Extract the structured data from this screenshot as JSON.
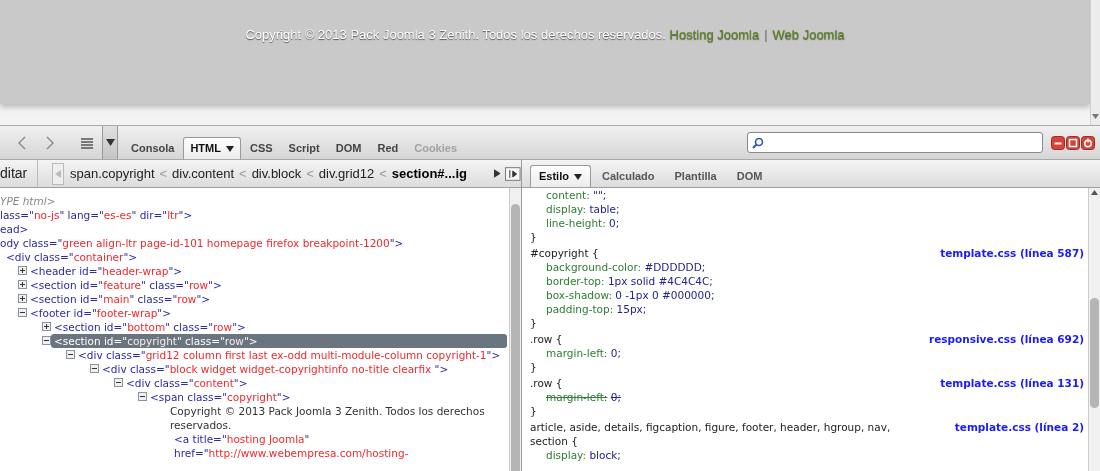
{
  "page": {
    "footer_parts": [
      {
        "kind": "text",
        "text": "Copyright © 2013 Pack Joomla 3 Zenith. Todos los derechos reservados."
      },
      {
        "kind": "link",
        "text": "Hosting Joomla"
      },
      {
        "kind": "separator",
        "text": "|"
      },
      {
        "kind": "link",
        "text": "Web Joomla"
      }
    ]
  },
  "toolbar": {
    "tabs": [
      {
        "label": "Consola",
        "selected": false,
        "disabled": false,
        "menu": false
      },
      {
        "label": "HTML",
        "selected": true,
        "disabled": false,
        "menu": true
      },
      {
        "label": "CSS",
        "selected": false,
        "disabled": false,
        "menu": false
      },
      {
        "label": "Script",
        "selected": false,
        "disabled": false,
        "menu": false
      },
      {
        "label": "DOM",
        "selected": false,
        "disabled": false,
        "menu": false
      },
      {
        "label": "Red",
        "selected": false,
        "disabled": false,
        "menu": false
      },
      {
        "label": "Cookies",
        "selected": false,
        "disabled": true,
        "menu": false
      }
    ]
  },
  "breadcrumb": {
    "edit_button": "ditar",
    "items": [
      {
        "kind": "crumb",
        "label": "span.copyright",
        "selected": false
      },
      {
        "kind": "separator",
        "label": "<"
      },
      {
        "kind": "crumb",
        "label": "div.content",
        "selected": false
      },
      {
        "kind": "separator",
        "label": "<"
      },
      {
        "kind": "crumb",
        "label": "div.block",
        "selected": false
      },
      {
        "kind": "separator",
        "label": "<"
      },
      {
        "kind": "crumb",
        "label": "div.grid12",
        "selected": false
      },
      {
        "kind": "separator",
        "label": "<"
      },
      {
        "kind": "crumb",
        "label": "section#...ig",
        "selected": true
      }
    ]
  },
  "html_tree": [
    {
      "kind": "doctype",
      "parts": [
        {
          "kind": "comment",
          "text": "YPE html>"
        }
      ]
    },
    {
      "kind": "element",
      "selected": false,
      "parts": [
        {
          "kind": "markup",
          "text": "lass=\""
        },
        {
          "kind": "value",
          "text": "no-js"
        },
        {
          "kind": "markup",
          "text": "\" lang=\""
        },
        {
          "kind": "value",
          "text": "es-es"
        },
        {
          "kind": "markup",
          "text": "\" dir=\""
        },
        {
          "kind": "value",
          "text": "ltr"
        },
        {
          "kind": "markup",
          "text": "\">"
        }
      ],
      "children": [
        {
          "kind": "element",
          "selected": false,
          "parts": [
            {
              "kind": "markup",
              "text": "ead>"
            }
          ]
        },
        {
          "kind": "element",
          "selected": false,
          "parts": [
            {
              "kind": "markup",
              "text": "ody class=\""
            },
            {
              "kind": "value",
              "text": "green align-ltr page-id-101 homepage firefox breakpoint-1200"
            },
            {
              "kind": "markup",
              "text": "\">"
            }
          ],
          "children": [
            {
              "kind": "element",
              "selected": false,
              "parts": [
                {
                  "kind": "markup",
                  "text": "<div class=\""
                },
                {
                  "kind": "value",
                  "text": "container"
                },
                {
                  "kind": "markup",
                  "text": "\">"
                }
              ],
              "children": [
                {
                  "kind": "element",
                  "selected": false,
                  "expanded": false,
                  "parts": [
                    {
                      "kind": "markup",
                      "text": "<header id=\""
                    },
                    {
                      "kind": "value",
                      "text": "header-wrap"
                    },
                    {
                      "kind": "markup",
                      "text": "\">"
                    }
                  ]
                },
                {
                  "kind": "element",
                  "selected": false,
                  "expanded": false,
                  "parts": [
                    {
                      "kind": "markup",
                      "text": "<section id=\""
                    },
                    {
                      "kind": "value",
                      "text": "feature"
                    },
                    {
                      "kind": "markup",
                      "text": "\" class=\""
                    },
                    {
                      "kind": "value",
                      "text": "row"
                    },
                    {
                      "kind": "markup",
                      "text": "\">"
                    }
                  ]
                },
                {
                  "kind": "element",
                  "selected": false,
                  "expanded": false,
                  "parts": [
                    {
                      "kind": "markup",
                      "text": "<section id=\""
                    },
                    {
                      "kind": "value",
                      "text": "main"
                    },
                    {
                      "kind": "markup",
                      "text": "\" class=\""
                    },
                    {
                      "kind": "value",
                      "text": "row"
                    },
                    {
                      "kind": "markup",
                      "text": "\">"
                    }
                  ]
                },
                {
                  "kind": "element",
                  "selected": false,
                  "expanded": true,
                  "parts": [
                    {
                      "kind": "markup",
                      "text": "<footer id=\""
                    },
                    {
                      "kind": "value",
                      "text": "footer-wrap"
                    },
                    {
                      "kind": "markup",
                      "text": "\">"
                    }
                  ],
                  "children": [
                    {
                      "kind": "element",
                      "selected": false,
                      "expanded": false,
                      "parts": [
                        {
                          "kind": "markup",
                          "text": "<section id=\""
                        },
                        {
                          "kind": "value",
                          "text": "bottom"
                        },
                        {
                          "kind": "markup",
                          "text": "\" class=\""
                        },
                        {
                          "kind": "value",
                          "text": "row"
                        },
                        {
                          "kind": "markup",
                          "text": "\">"
                        }
                      ]
                    },
                    {
                      "kind": "element",
                      "selected": true,
                      "expanded": true,
                      "parts": [
                        {
                          "kind": "markup",
                          "text": "<section id=\""
                        },
                        {
                          "kind": "value",
                          "text": "copyright"
                        },
                        {
                          "kind": "markup",
                          "text": "\" class=\""
                        },
                        {
                          "kind": "value",
                          "text": "row"
                        },
                        {
                          "kind": "markup",
                          "text": "\">"
                        }
                      ],
                      "children": [
                        {
                          "kind": "element",
                          "selected": false,
                          "expanded": true,
                          "parts": [
                            {
                              "kind": "markup",
                              "text": "<div class=\""
                            },
                            {
                              "kind": "value",
                              "text": "grid12 column first last ex-odd multi-module-column copyright-1"
                            },
                            {
                              "kind": "markup",
                              "text": "\">"
                            }
                          ],
                          "children": [
                            {
                              "kind": "element",
                              "selected": false,
                              "expanded": true,
                              "parts": [
                                {
                                  "kind": "markup",
                                  "text": "<div class=\""
                                },
                                {
                                  "kind": "value",
                                  "text": "block widget widget-copyrightinfo no-title clearfix "
                                },
                                {
                                  "kind": "markup",
                                  "text": "\">"
                                }
                              ],
                              "children": [
                                {
                                  "kind": "element",
                                  "selected": false,
                                  "expanded": true,
                                  "parts": [
                                    {
                                      "kind": "markup",
                                      "text": "<div class=\""
                                    },
                                    {
                                      "kind": "value",
                                      "text": "content"
                                    },
                                    {
                                      "kind": "markup",
                                      "text": "\">"
                                    }
                                  ],
                                  "children": [
                                    {
                                      "kind": "element",
                                      "selected": false,
                                      "expanded": true,
                                      "parts": [
                                        {
                                          "kind": "markup",
                                          "text": "<span class=\""
                                        },
                                        {
                                          "kind": "value",
                                          "text": "copyright"
                                        },
                                        {
                                          "kind": "markup",
                                          "text": "\">"
                                        }
                                      ],
                                      "children": [
                                        {
                                          "kind": "text",
                                          "parts": [
                                            {
                                              "kind": "text",
                                              "text": "Copyright © 2013 Pack Joomla 3 Zenith. Todos los derechos reservados."
                                            }
                                          ]
                                        },
                                        {
                                          "kind": "element",
                                          "selected": false,
                                          "parts": [
                                            {
                                              "kind": "markup",
                                              "text": "<a title=\""
                                            },
                                            {
                                              "kind": "value",
                                              "text": "hosting Joomla"
                                            },
                                            {
                                              "kind": "markup",
                                              "text": "\" href=\""
                                            },
                                            {
                                              "kind": "value",
                                              "text": "http://www.webempresa.com/hosting-"
                                            }
                                          ]
                                        }
                                      ]
                                    }
                                  ]
                                }
                              ]
                            }
                          ]
                        }
                      ]
                    }
                  ]
                }
              ]
            }
          ]
        }
      ]
    }
  ],
  "style_panel": {
    "tabs": [
      {
        "label": "Estilo",
        "selected": true,
        "menu": true
      },
      {
        "label": "Calculado",
        "selected": false,
        "menu": false
      },
      {
        "label": "Plantilla",
        "selected": false,
        "menu": false
      },
      {
        "label": "DOM",
        "selected": false,
        "menu": false
      }
    ],
    "rules": [
      {
        "declarations": [
          {
            "name": "content:",
            "value": "\"\";",
            "overridden": false
          },
          {
            "name": "display:",
            "value": "table;",
            "overridden": false
          },
          {
            "name": "line-height:",
            "value": "0;",
            "overridden": false
          }
        ],
        "close": "}"
      },
      {
        "selector": "#copyright {",
        "source": "template.css (línea 587)",
        "declarations": [
          {
            "name": "background-color:",
            "value": "#DDDDDD;",
            "overridden": false
          },
          {
            "name": "border-top:",
            "value": "1px solid #4C4C4C;",
            "overridden": false
          },
          {
            "name": "box-shadow:",
            "value": "0 -1px 0 #000000;",
            "overridden": false
          },
          {
            "name": "padding-top:",
            "value": "15px;",
            "overridden": false
          }
        ],
        "close": "}"
      },
      {
        "selector": ".row {",
        "source": "responsive.css (línea 692)",
        "declarations": [
          {
            "name": "margin-left:",
            "value": "0;",
            "overridden": false
          }
        ],
        "close": "}"
      },
      {
        "selector": ".row {",
        "source": "template.css (línea 131)",
        "declarations": [
          {
            "name": "margin-left:",
            "value": "0;",
            "overridden": true
          }
        ],
        "close": "}"
      },
      {
        "selector": "article, aside, details, figcaption, figure, footer, header, hgroup, nav, section {",
        "source": "template.css (línea 2)",
        "declarations": [
          {
            "name": "display:",
            "value": "block;",
            "overridden": false
          }
        ]
      }
    ]
  }
}
